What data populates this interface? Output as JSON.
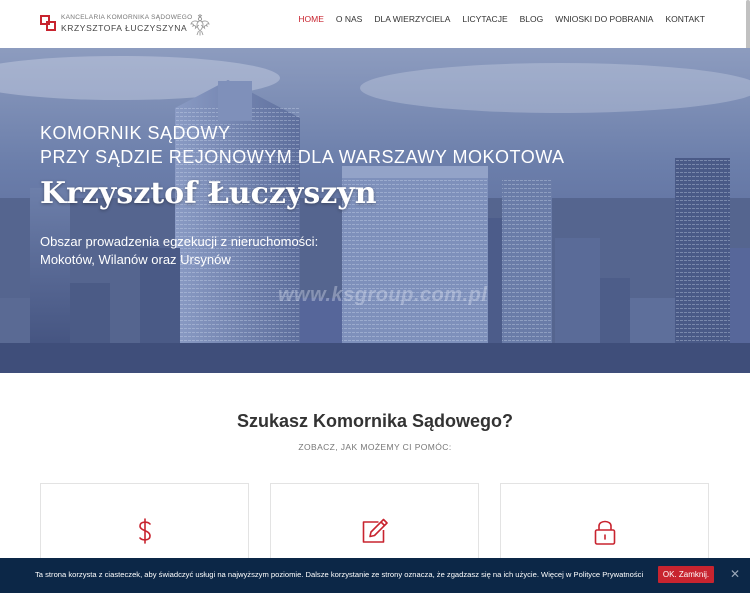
{
  "header": {
    "logo_line1": "Kancelaria Komornika Sądowego",
    "logo_line2": "Krzysztofa Łuczyszyna"
  },
  "nav": {
    "items": [
      {
        "label": "HOME",
        "active": true
      },
      {
        "label": "O NAS"
      },
      {
        "label": "DLA WIERZYCIELA"
      },
      {
        "label": "LICYTACJE"
      },
      {
        "label": "BLOG"
      },
      {
        "label": "WNIOSKI DO POBRANIA"
      },
      {
        "label": "KONTAKT"
      }
    ]
  },
  "hero": {
    "subtitle_line1": "Komornik Sądowy",
    "subtitle_line2": "przy Sądzie Rejonowym dla Warszawy Mokotowa",
    "name": "Krzysztof Łuczyszyn",
    "desc_line1": "Obszar prowadzenia egzekucji z nieruchomości:",
    "desc_line2": "Mokotów, Wilanów oraz Ursynów",
    "watermark": "www.ksgroup.com.pl"
  },
  "section": {
    "title": "Szukasz Komornika Sądowego?",
    "subtitle": "ZOBACZ, JAK MOŻEMY CI POMÓC:"
  },
  "cards": [
    {
      "icon": "dollar-icon"
    },
    {
      "icon": "edit-icon"
    },
    {
      "icon": "lock-icon"
    }
  ],
  "cookie": {
    "text": "Ta strona korzysta z ciasteczek, aby świadczyć usługi na najwyższym poziomie. Dalsze korzystanie ze strony oznacza, że zgadzasz się na ich użycie. Więcej w Polityce Prywatności",
    "button_label": "OK. Zamknij.",
    "close_label": "✕"
  },
  "colors": {
    "accent": "#c8242f",
    "cookie_bg": "#0c2747"
  }
}
